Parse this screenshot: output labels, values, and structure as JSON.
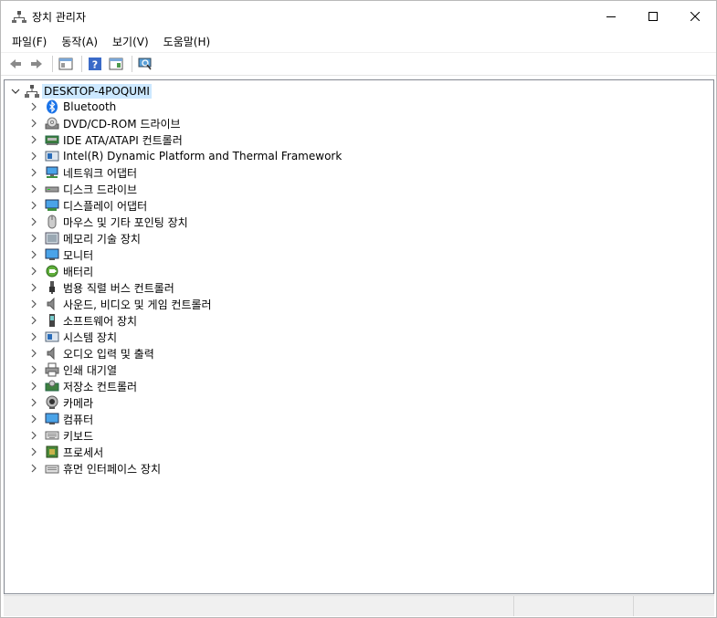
{
  "window": {
    "title": "장치 관리자"
  },
  "menu": [
    {
      "label": "파일(F)"
    },
    {
      "label": "동작(A)"
    },
    {
      "label": "보기(V)"
    },
    {
      "label": "도움말(H)"
    }
  ],
  "tree": {
    "root": "DESKTOP-4POQUMI",
    "items": [
      {
        "label": "Bluetooth",
        "icon": "bluetooth-icon"
      },
      {
        "label": "DVD/CD-ROM 드라이브",
        "icon": "dvd-drive-icon"
      },
      {
        "label": "IDE ATA/ATAPI 컨트롤러",
        "icon": "ide-controller-icon"
      },
      {
        "label": "Intel(R) Dynamic Platform and Thermal Framework",
        "icon": "intel-framework-icon"
      },
      {
        "label": "네트워크 어댑터",
        "icon": "network-adapter-icon"
      },
      {
        "label": "디스크 드라이브",
        "icon": "disk-drive-icon"
      },
      {
        "label": "디스플레이 어댑터",
        "icon": "display-adapter-icon"
      },
      {
        "label": "마우스 및 기타 포인팅 장치",
        "icon": "mouse-icon"
      },
      {
        "label": "메모리 기술 장치",
        "icon": "memory-device-icon"
      },
      {
        "label": "모니터",
        "icon": "monitor-icon"
      },
      {
        "label": "배터리",
        "icon": "battery-icon"
      },
      {
        "label": "범용 직렬 버스 컨트롤러",
        "icon": "usb-controller-icon"
      },
      {
        "label": "사운드, 비디오 및 게임 컨트롤러",
        "icon": "sound-icon"
      },
      {
        "label": "소프트웨어 장치",
        "icon": "software-device-icon"
      },
      {
        "label": "시스템 장치",
        "icon": "system-device-icon"
      },
      {
        "label": "오디오 입력 및 출력",
        "icon": "audio-io-icon"
      },
      {
        "label": "인쇄 대기열",
        "icon": "print-queue-icon"
      },
      {
        "label": "저장소 컨트롤러",
        "icon": "storage-controller-icon"
      },
      {
        "label": "카메라",
        "icon": "camera-icon"
      },
      {
        "label": "컴퓨터",
        "icon": "computer-icon"
      },
      {
        "label": "키보드",
        "icon": "keyboard-icon"
      },
      {
        "label": "프로세서",
        "icon": "processor-icon"
      },
      {
        "label": "휴먼 인터페이스 장치",
        "icon": "hid-icon"
      }
    ]
  }
}
